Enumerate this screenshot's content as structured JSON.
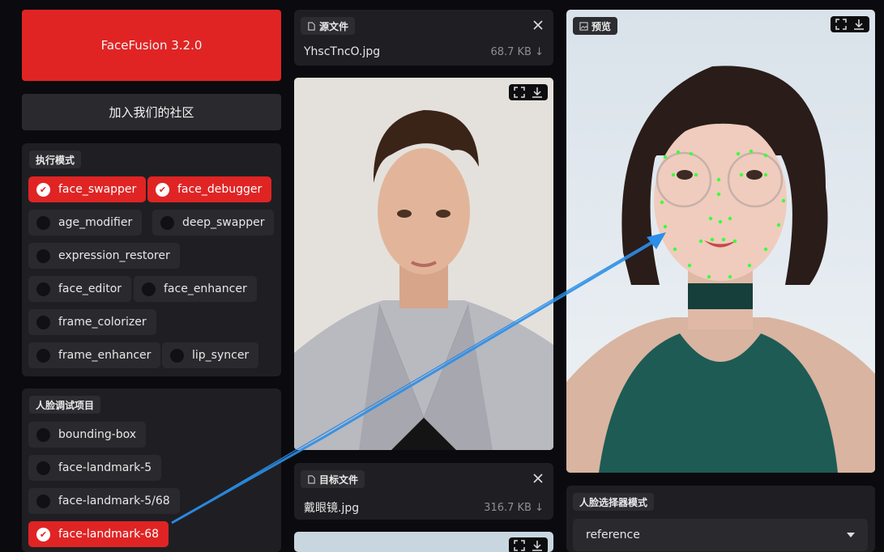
{
  "header": {
    "title": "FaceFusion 3.2.0",
    "community_label": "加入我们的社区"
  },
  "processors": {
    "label": "执行模式",
    "items": [
      {
        "label": "face_swapper",
        "checked": true
      },
      {
        "label": "face_debugger",
        "checked": true
      },
      {
        "label": "age_modifier",
        "checked": false
      },
      {
        "label": "deep_swapper",
        "checked": false
      },
      {
        "label": "expression_restorer",
        "checked": false
      },
      {
        "label": "face_editor",
        "checked": false
      },
      {
        "label": "face_enhancer",
        "checked": false
      },
      {
        "label": "frame_colorizer",
        "checked": false
      },
      {
        "label": "frame_enhancer",
        "checked": false
      },
      {
        "label": "lip_syncer",
        "checked": false
      }
    ]
  },
  "debugger": {
    "label": "人脸调试项目",
    "items": [
      {
        "label": "bounding-box",
        "checked": false
      },
      {
        "label": "face-landmark-5",
        "checked": false
      },
      {
        "label": "face-landmark-5/68",
        "checked": false
      },
      {
        "label": "face-landmark-68",
        "checked": true
      }
    ]
  },
  "source": {
    "label": "源文件",
    "filename": "YhscTncO.jpg",
    "size": "68.7 KB ↓"
  },
  "target": {
    "label": "目标文件",
    "filename": "戴眼镜.jpg",
    "size": "316.7 KB ↓"
  },
  "preview": {
    "label": "预览"
  },
  "face_selector": {
    "label": "人脸选择器模式",
    "value": "reference"
  },
  "colors": {
    "accent": "#e02424",
    "panel": "#1f1f23",
    "annotation_arrow": "#2b8ee8",
    "landmark": "#3cff3c"
  }
}
